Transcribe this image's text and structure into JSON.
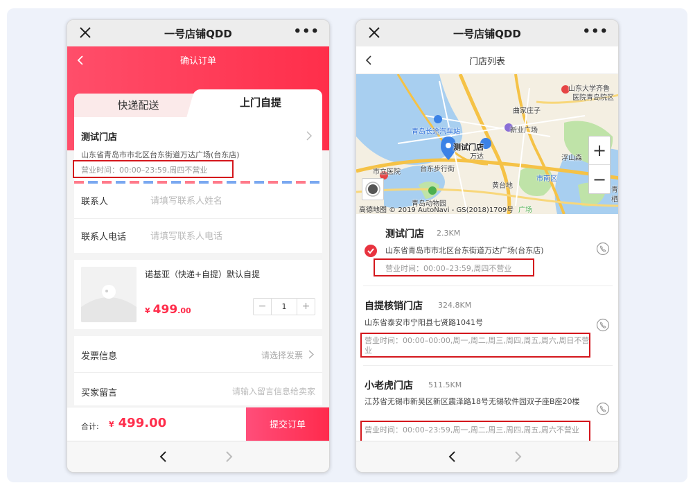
{
  "wechat": {
    "title": "一号店铺QDD"
  },
  "order": {
    "header_title": "确认订单",
    "tabs": [
      {
        "label": "快递配送"
      },
      {
        "label": "上门自提"
      }
    ],
    "store": {
      "name": "测试门店",
      "address": "山东省青岛市市北区台东街道万达广场(台东店)",
      "hours": "营业时间：00:00–23:59,周四不营业"
    },
    "contact": {
      "name_label": "联系人",
      "name_placeholder": "请填写联系人姓名",
      "phone_label": "联系人电话",
      "phone_placeholder": "请填写联系人电话"
    },
    "product": {
      "name": "诺基亚（快递+自提）默认自提",
      "currency": "¥",
      "price_int": "499",
      "price_dec": ".00",
      "quantity": "1",
      "minus": "−",
      "plus": "+"
    },
    "invoice": {
      "label": "发票信息",
      "value": "请选择发票"
    },
    "message": {
      "label": "买家留言",
      "placeholder": "请输入留言信息给卖家"
    },
    "footer": {
      "total_label": "合计:",
      "currency": "¥",
      "total": "499.00",
      "submit_label": "提交订单"
    }
  },
  "store_list": {
    "header_title": "门店列表",
    "map": {
      "labels": {
        "univ": "山东大学齐鲁",
        "hosp_a": "医院青岛院区",
        "bus": "青岛长途汽车站",
        "plaza": "新业广场",
        "store": "测试门店",
        "mall": "万达",
        "city_hosp": "市立医院",
        "street": "台东步行街",
        "district": "市南区",
        "zoo": "青岛动物园",
        "huangtai": "黄台地",
        "fushan": "浮山森",
        "qujiao": "曲家庄子",
        "edge": "青",
        "edge2": "栖"
      },
      "zoom_in": "+",
      "zoom_out": "−",
      "copyright": "高德地图 © 2019 AutoNavi - GS(2018)1709号",
      "overlap": "广场"
    },
    "items": [
      {
        "name": "测试门店",
        "distance": "2.3KM",
        "address": "山东省青岛市市北区台东街道万达广场(台东店)",
        "hours": "营业时间：00:00–23:59,周四不营业",
        "selected": true
      },
      {
        "name": "自提核销门店",
        "distance": "324.8KM",
        "address": "山东省泰安市宁阳县七贤路1041号",
        "hours": "营业时间：00:00–00:00,周一,周二,周三,周四,周五,周六,周日不营业",
        "selected": false
      },
      {
        "name": "小老虎门店",
        "distance": "511.5KM",
        "address": "江苏省无锡市新吴区新区震泽路18号无锡软件园双子座B座20楼",
        "hours": "营业时间：00:00–23:59,周一,周二,周三,周四,周五,周六不营业",
        "selected": false
      }
    ]
  },
  "colors": {
    "accent": "#ff2d4b",
    "highlight": "#d4161c",
    "map_blue": "#3b82e6"
  }
}
